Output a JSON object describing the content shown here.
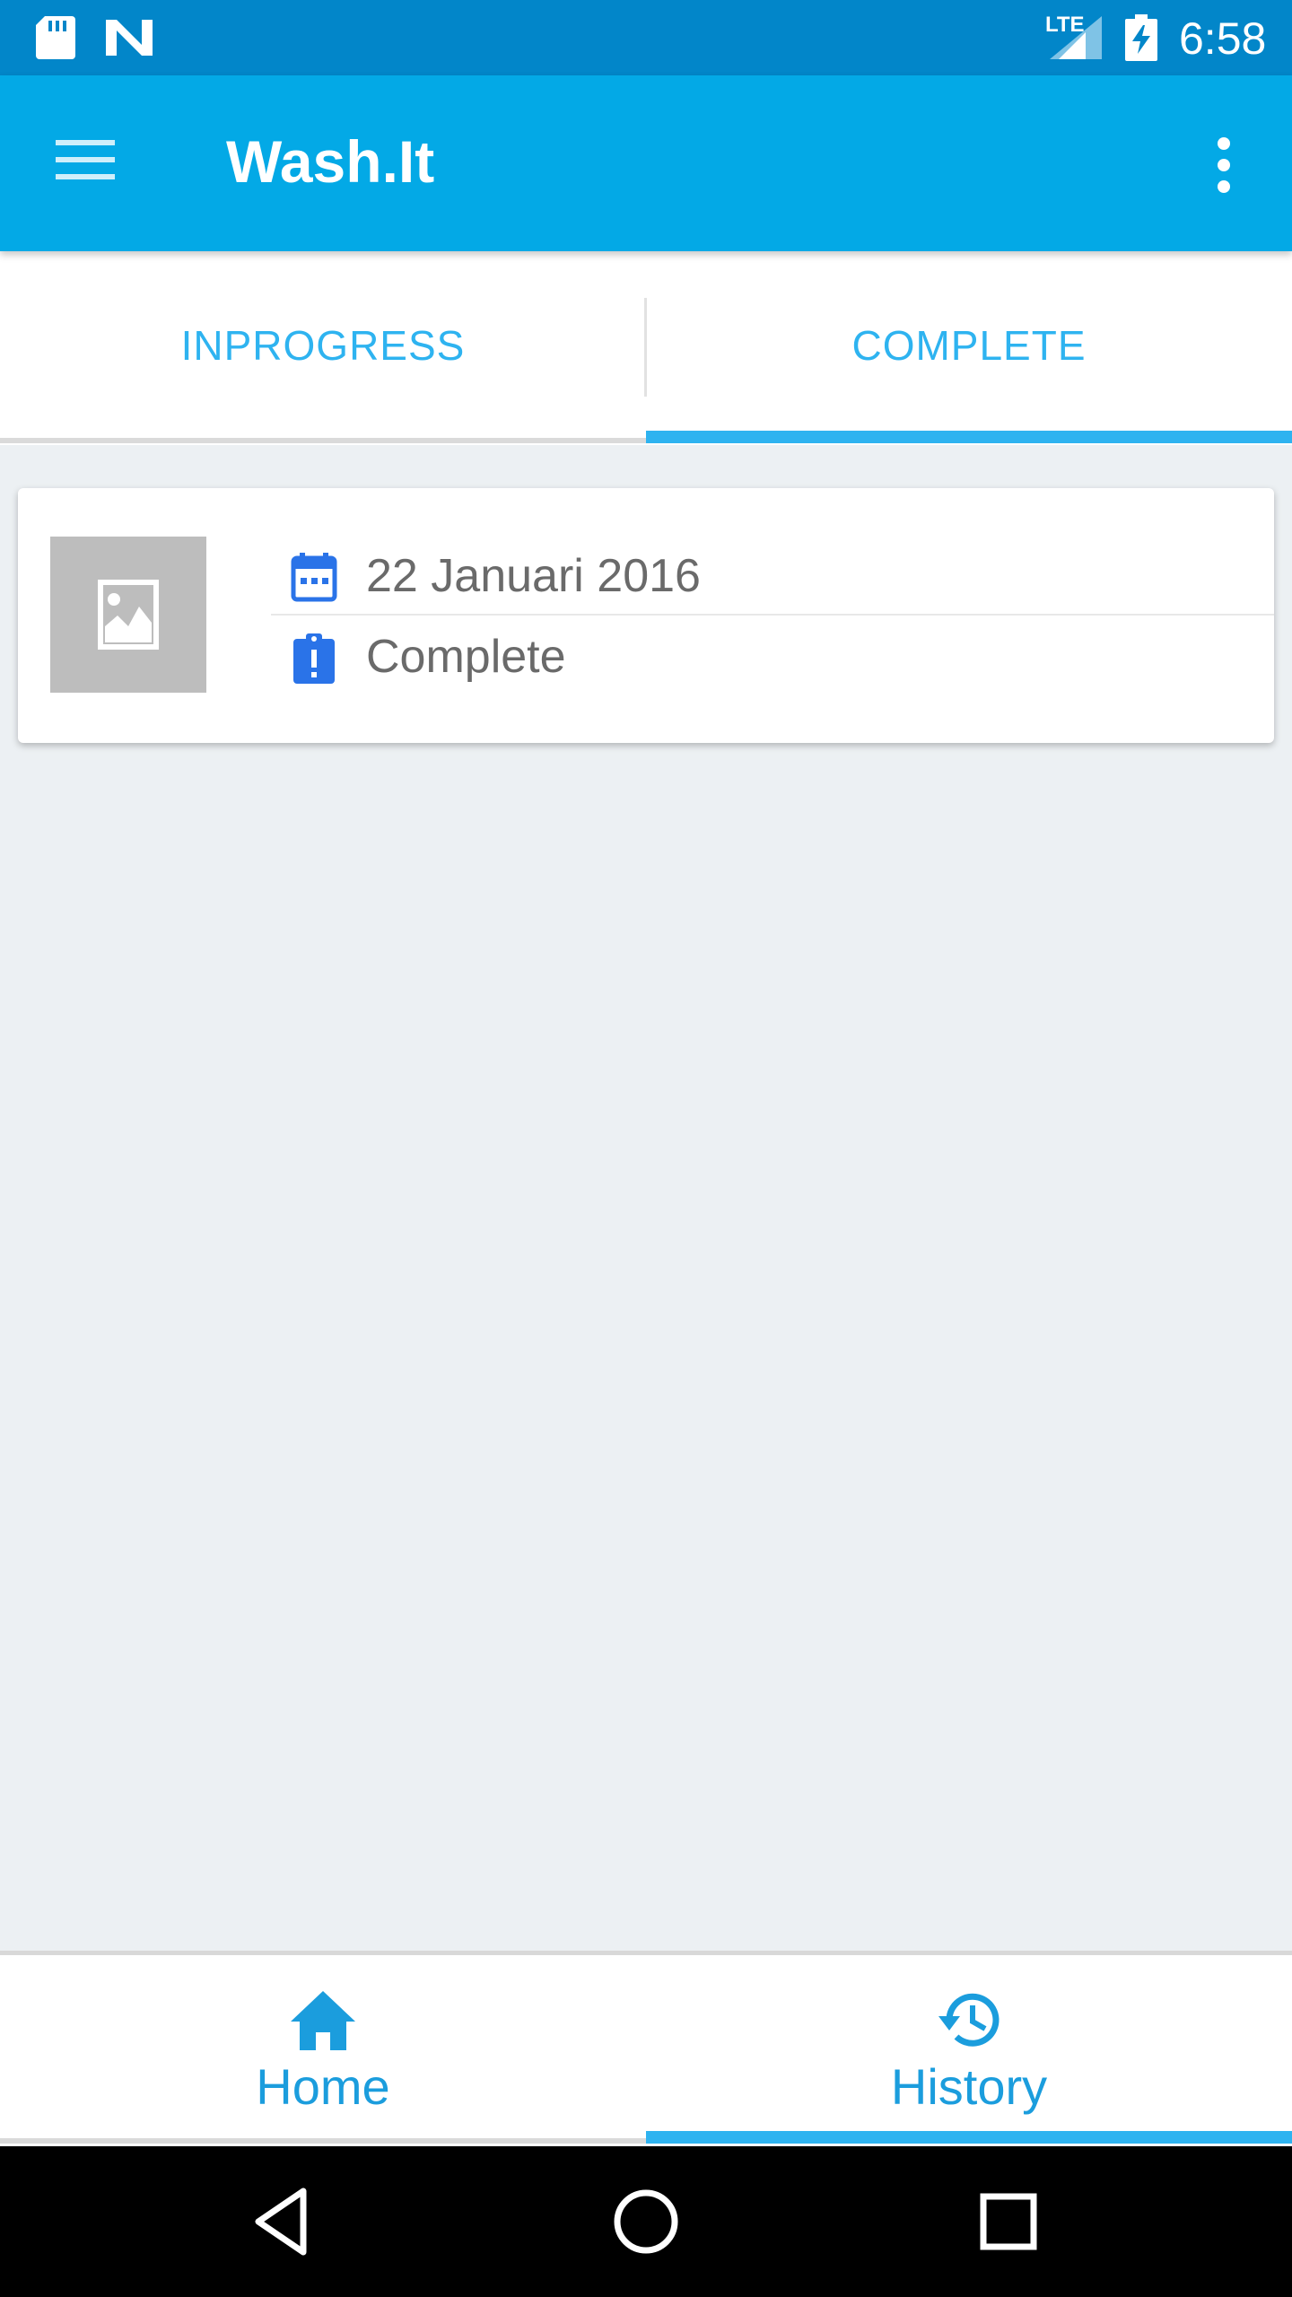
{
  "status_bar": {
    "network": "LTE",
    "time": "6:58",
    "icons": [
      "sd-card-icon",
      "n-logo-icon",
      "signal-icon",
      "battery-charging-icon"
    ]
  },
  "app_bar": {
    "title": "Wash.It",
    "icons": [
      "hamburger-menu-icon",
      "more-vert-icon"
    ]
  },
  "tabs": {
    "items": [
      {
        "label": "INPROGRESS",
        "selected": false
      },
      {
        "label": "COMPLETE",
        "selected": true
      }
    ]
  },
  "order_card": {
    "thumbnail_icon": "image-placeholder-icon",
    "date": "22 Januari 2016",
    "status": "Complete",
    "date_icon": "calendar-icon",
    "status_icon": "clipboard-alert-icon"
  },
  "bottom_nav": {
    "items": [
      {
        "label": "Home",
        "icon": "home-icon",
        "selected": false
      },
      {
        "label": "History",
        "icon": "history-icon",
        "selected": true
      }
    ]
  },
  "colors": {
    "status_bar": "#0286C9",
    "app_bar": "#03A9E6",
    "accent": "#2EB3F0",
    "background": "#ECF0F3",
    "icon_blue": "#2A73E8"
  }
}
